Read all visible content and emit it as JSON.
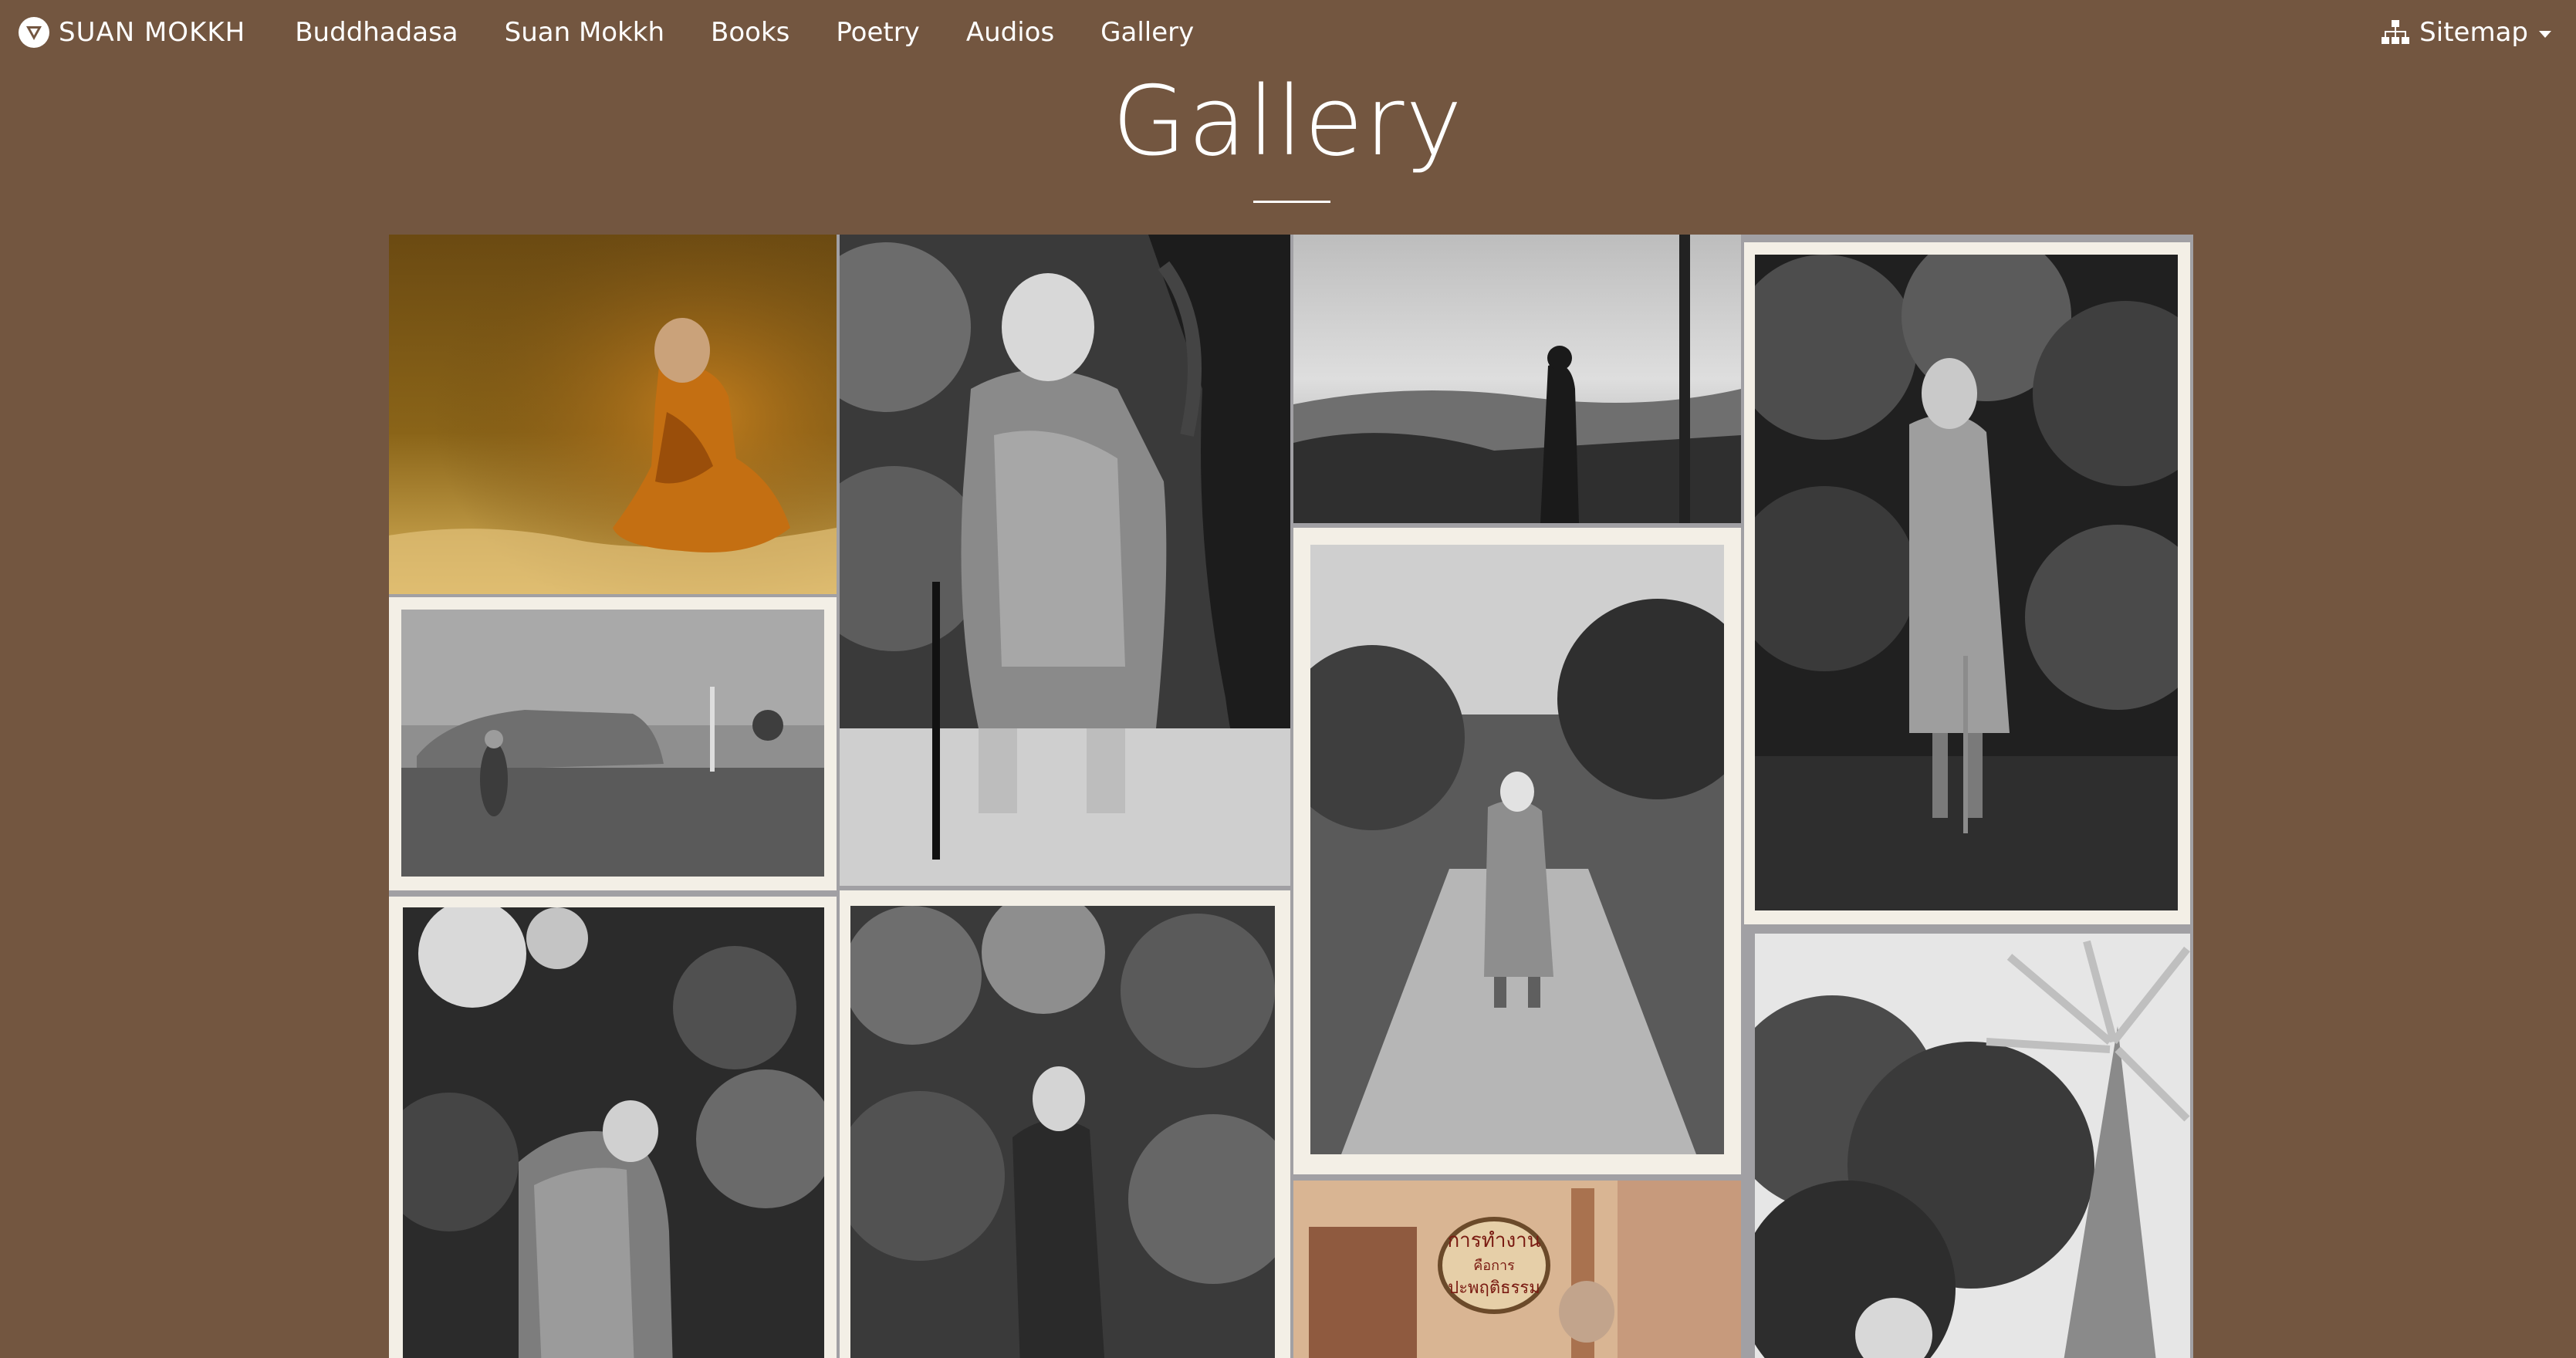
{
  "nav": {
    "brand": "SUAN MOKKH",
    "brand_icon": "suan-mokkh-logo-icon",
    "links": [
      "Buddhadasa",
      "Suan Mokkh",
      "Books",
      "Poetry",
      "Audios",
      "Gallery"
    ],
    "sitemap": "Sitemap",
    "sitemap_icon": "sitemap-icon"
  },
  "page": {
    "title": "Gallery"
  },
  "colors": {
    "background": "#735640",
    "text": "#ffffff",
    "gallery_gutter": "#a1a0a4"
  },
  "gallery": {
    "sign_text_line1": "การทำงาน",
    "sign_text_line2": "คือการ",
    "sign_text_line3": "ปะพฤติธรรม",
    "photos": [
      "monk-seated-in-grass-painting",
      "monk-standing-with-cane-drawing",
      "monk-silhouette-on-hill",
      "monk-standing-among-leaves",
      "monk-walking-on-open-field",
      "monk-on-forest-path",
      "monk-from-behind-in-garden",
      "monk-looking-up-in-forest",
      "monk-with-work-sign",
      "monk-near-palm-tree"
    ]
  }
}
